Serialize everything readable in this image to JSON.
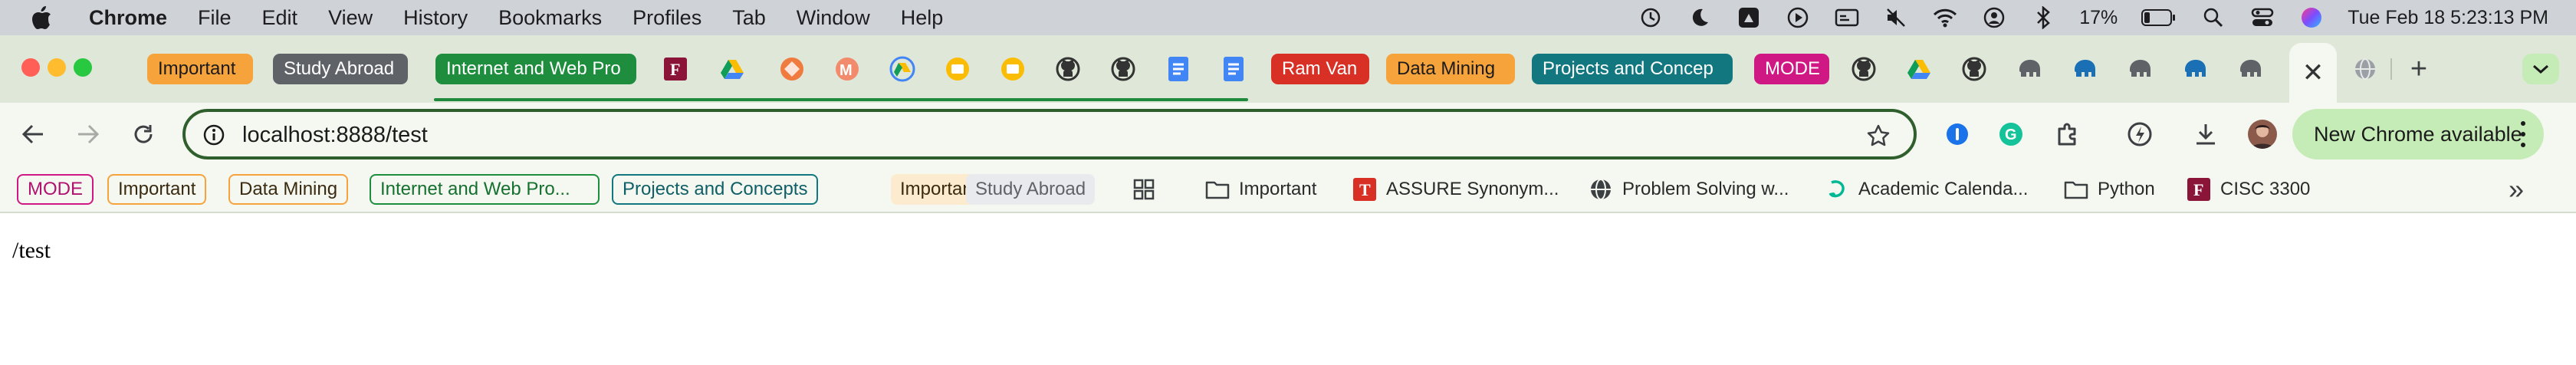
{
  "menubar": {
    "app_name": "Chrome",
    "items": [
      "File",
      "Edit",
      "View",
      "History",
      "Bookmarks",
      "Profiles",
      "Tab",
      "Window",
      "Help"
    ],
    "battery_percent": "17%",
    "datetime": "Tue Feb 18  5:23:13 PM",
    "status_icons": [
      "time-machine-icon",
      "moon-icon",
      "drive-icon",
      "play-icon",
      "card-icon",
      "muted-speaker-icon",
      "wifi-icon",
      "user-icon",
      "bluetooth-icon",
      "battery-icon",
      "search-icon",
      "control-center-icon",
      "siri-icon"
    ]
  },
  "tabs": {
    "group_chips": [
      {
        "label": "Important",
        "color": "#f6a33b"
      },
      {
        "label": "Study Abroad",
        "color": "#5f6368"
      },
      {
        "label": "Internet and Web Pro",
        "color": "#1e8e3e"
      },
      {
        "label": "Ram Van",
        "color": "#d93025"
      },
      {
        "label": "Data Mining",
        "color": "#f6a33b"
      },
      {
        "label": "Projects and Concep",
        "color": "#12777f"
      },
      {
        "label": "MODE",
        "color": "#d01884"
      }
    ],
    "favicons": [
      "fordham-icon",
      "google-drive-icon",
      "diamond-icon",
      "m-logo-icon",
      "drive-sync-icon",
      "slides-icon",
      "slides-icon",
      "github-icon",
      "github-icon",
      "docs-icon",
      "docs-icon",
      "github-icon",
      "google-drive-icon",
      "github-icon",
      "elephant-icon",
      "elephant-icon",
      "elephant-icon",
      "elephant-icon",
      "elephant-icon",
      "globe-icon"
    ],
    "active_tab_close": "✕",
    "new_tab": "+"
  },
  "toolbar": {
    "url": "localhost:8888/test",
    "update_label": "New Chrome available"
  },
  "bookmarks": {
    "chips": [
      {
        "label": "MODE",
        "color": "#d01884"
      },
      {
        "label": "Important",
        "color": "#f6a33b"
      },
      {
        "label": "Data Mining",
        "color": "#f6a33b"
      },
      {
        "label": "Internet and Web Pro...",
        "color": "#1e8e3e"
      },
      {
        "label": "Projects and Concepts",
        "color": "#12777f"
      },
      {
        "label": "Important",
        "color": "#f6a33b"
      },
      {
        "label": "Study Abroad",
        "color": "#5f6368"
      }
    ],
    "items": [
      {
        "label": "Important",
        "icon": "folder-icon"
      },
      {
        "label": "ASSURE Synonym...",
        "icon": "fordham-icon"
      },
      {
        "label": "Problem Solving w...",
        "icon": "globe-icon"
      },
      {
        "label": "Academic Calenda...",
        "icon": "grammarly-like-icon"
      },
      {
        "label": "Python",
        "icon": "folder-icon"
      },
      {
        "label": "CISC 3300",
        "icon": "fordham-icon"
      }
    ],
    "overflow": "»"
  },
  "page": {
    "text": "/test"
  }
}
